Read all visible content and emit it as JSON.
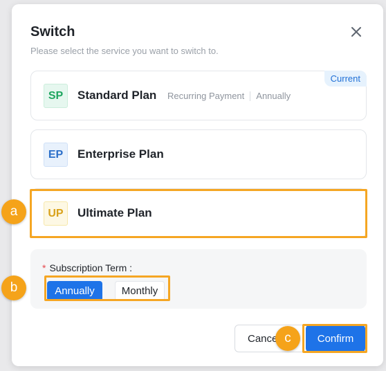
{
  "dialog": {
    "title": "Switch",
    "subtitle": "Please select the service you want to switch to."
  },
  "plans": [
    {
      "badge": "SP",
      "name": "Standard Plan",
      "meta": [
        "Recurring Payment",
        "Annually"
      ],
      "tag": "Current"
    },
    {
      "badge": "EP",
      "name": "Enterprise Plan"
    },
    {
      "badge": "UP",
      "name": "Ultimate Plan"
    }
  ],
  "term": {
    "required_mark": "*",
    "label": "Subscription Term",
    "colon": ":",
    "options": [
      "Annually",
      "Monthly"
    ],
    "selected": "Annually"
  },
  "footer": {
    "cancel": "Cancel",
    "confirm": "Confirm"
  },
  "markers": [
    "a",
    "b",
    "c"
  ],
  "colors": {
    "accent": "#1e73e8",
    "highlight": "#f5a623",
    "marker": "#f5a31a"
  },
  "icons": {
    "close": "close-icon"
  }
}
